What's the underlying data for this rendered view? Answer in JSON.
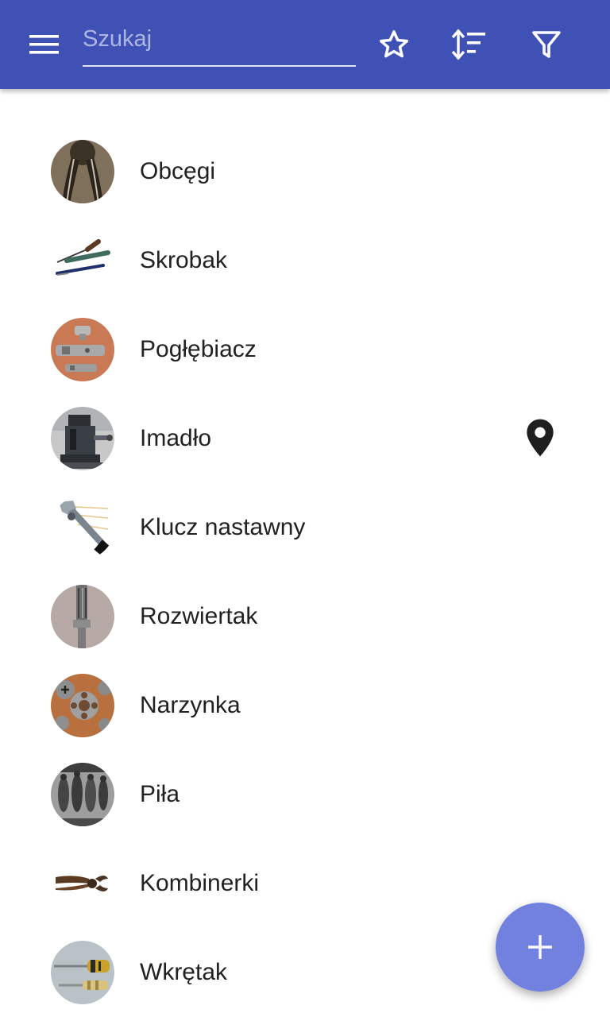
{
  "app_bar": {
    "color": "#3f51b5",
    "menu_icon": "menu-icon",
    "search": {
      "placeholder": "Szukaj",
      "value": ""
    },
    "actions": [
      "star-outline-icon",
      "sort-icon",
      "filter-icon"
    ]
  },
  "tools": {
    "items": [
      {
        "name": "Obcęgi",
        "thumbnail": "pincers-photo"
      },
      {
        "name": "Skrobak",
        "thumbnail": "scraper-photo"
      },
      {
        "name": "Pogłębiacz",
        "thumbnail": "countersink-photo"
      },
      {
        "name": "Imadło",
        "thumbnail": "vise-photo",
        "has_location": true,
        "location_icon": "map-pin-icon"
      },
      {
        "name": "Klucz nastawny",
        "thumbnail": "adjustable-wrench-photo"
      },
      {
        "name": "Rozwiertak",
        "thumbnail": "reamer-photo"
      },
      {
        "name": "Narzynka",
        "thumbnail": "die-photo"
      },
      {
        "name": "Piła",
        "thumbnail": "saw-photo"
      },
      {
        "name": "Kombinerki",
        "thumbnail": "combination-pliers-photo"
      },
      {
        "name": "Wkrętak",
        "thumbnail": "screwdriver-photo"
      }
    ]
  },
  "fab": {
    "icon": "plus-icon",
    "color": "#7280e0"
  }
}
